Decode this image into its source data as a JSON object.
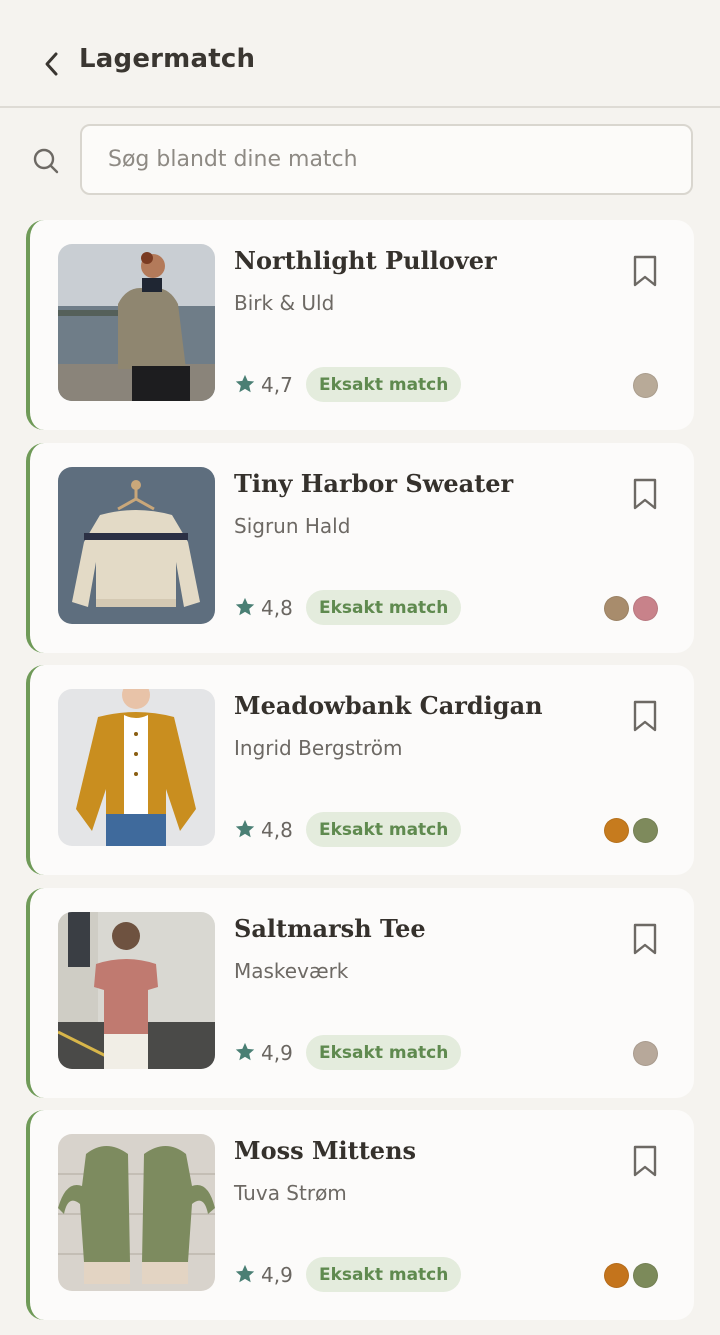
{
  "header": {
    "title": "Lagermatch"
  },
  "search": {
    "placeholder": "Søg blandt dine match"
  },
  "cards": [
    {
      "title": "Northlight Pullover",
      "designer": "Birk & Uld",
      "rating": "4,7",
      "badge": "Eksakt match",
      "swatches": [
        "#b8aa98"
      ]
    },
    {
      "title": "Tiny Harbor Sweater",
      "designer": "Sigrun Hald",
      "rating": "4,8",
      "badge": "Eksakt match",
      "swatches": [
        "#a88c6c",
        "#c8828a"
      ]
    },
    {
      "title": "Meadowbank Cardigan",
      "designer": "Ingrid Bergström",
      "rating": "4,8",
      "badge": "Eksakt match",
      "swatches": [
        "#c67b1e",
        "#7e8a5c"
      ]
    },
    {
      "title": "Saltmarsh Tee",
      "designer": "Maskeværk",
      "rating": "4,9",
      "badge": "Eksakt match",
      "swatches": [
        "#b7a89a"
      ]
    },
    {
      "title": "Moss Mittens",
      "designer": "Tuva Strøm",
      "rating": "4,9",
      "badge": "Eksakt match",
      "swatches": [
        "#c4741c",
        "#7c8a5a"
      ]
    }
  ],
  "colors": {
    "accent": "#6f9a58",
    "star": "#4a7f74",
    "badge_bg": "#e4ecdd",
    "badge_text": "#5f8a4f"
  }
}
